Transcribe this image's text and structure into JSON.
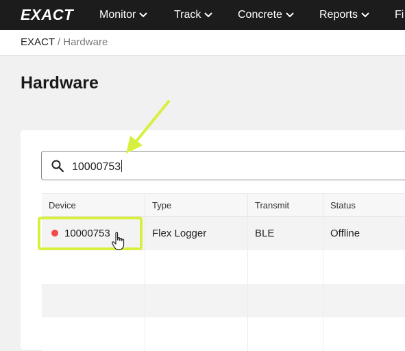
{
  "app": {
    "logo": "EXACT"
  },
  "nav": {
    "items": [
      {
        "label": "Monitor"
      },
      {
        "label": "Track"
      },
      {
        "label": "Concrete"
      },
      {
        "label": "Reports"
      },
      {
        "label": "Fi"
      }
    ]
  },
  "breadcrumb": {
    "root": "EXACT",
    "separator": "/",
    "current": "Hardware"
  },
  "page": {
    "title": "Hardware"
  },
  "search": {
    "value": "10000753"
  },
  "table": {
    "headers": [
      "Device",
      "Type",
      "Transmit",
      "Status"
    ],
    "rows": [
      {
        "device": "10000753",
        "type": "Flex Logger",
        "transmit": "BLE",
        "status": "Offline",
        "status_color": "#f04a4a"
      }
    ]
  },
  "colors": {
    "nav_bg": "#1c1c1c",
    "highlight": "#d9ef3e",
    "offline_dot": "#f04a4a",
    "stripe": "#f3f3f3"
  },
  "icons": {
    "search": "search-icon",
    "chevron": "chevron-down-icon",
    "cursor": "hand-pointer-icon",
    "annotation": "arrow-annotation-icon"
  }
}
